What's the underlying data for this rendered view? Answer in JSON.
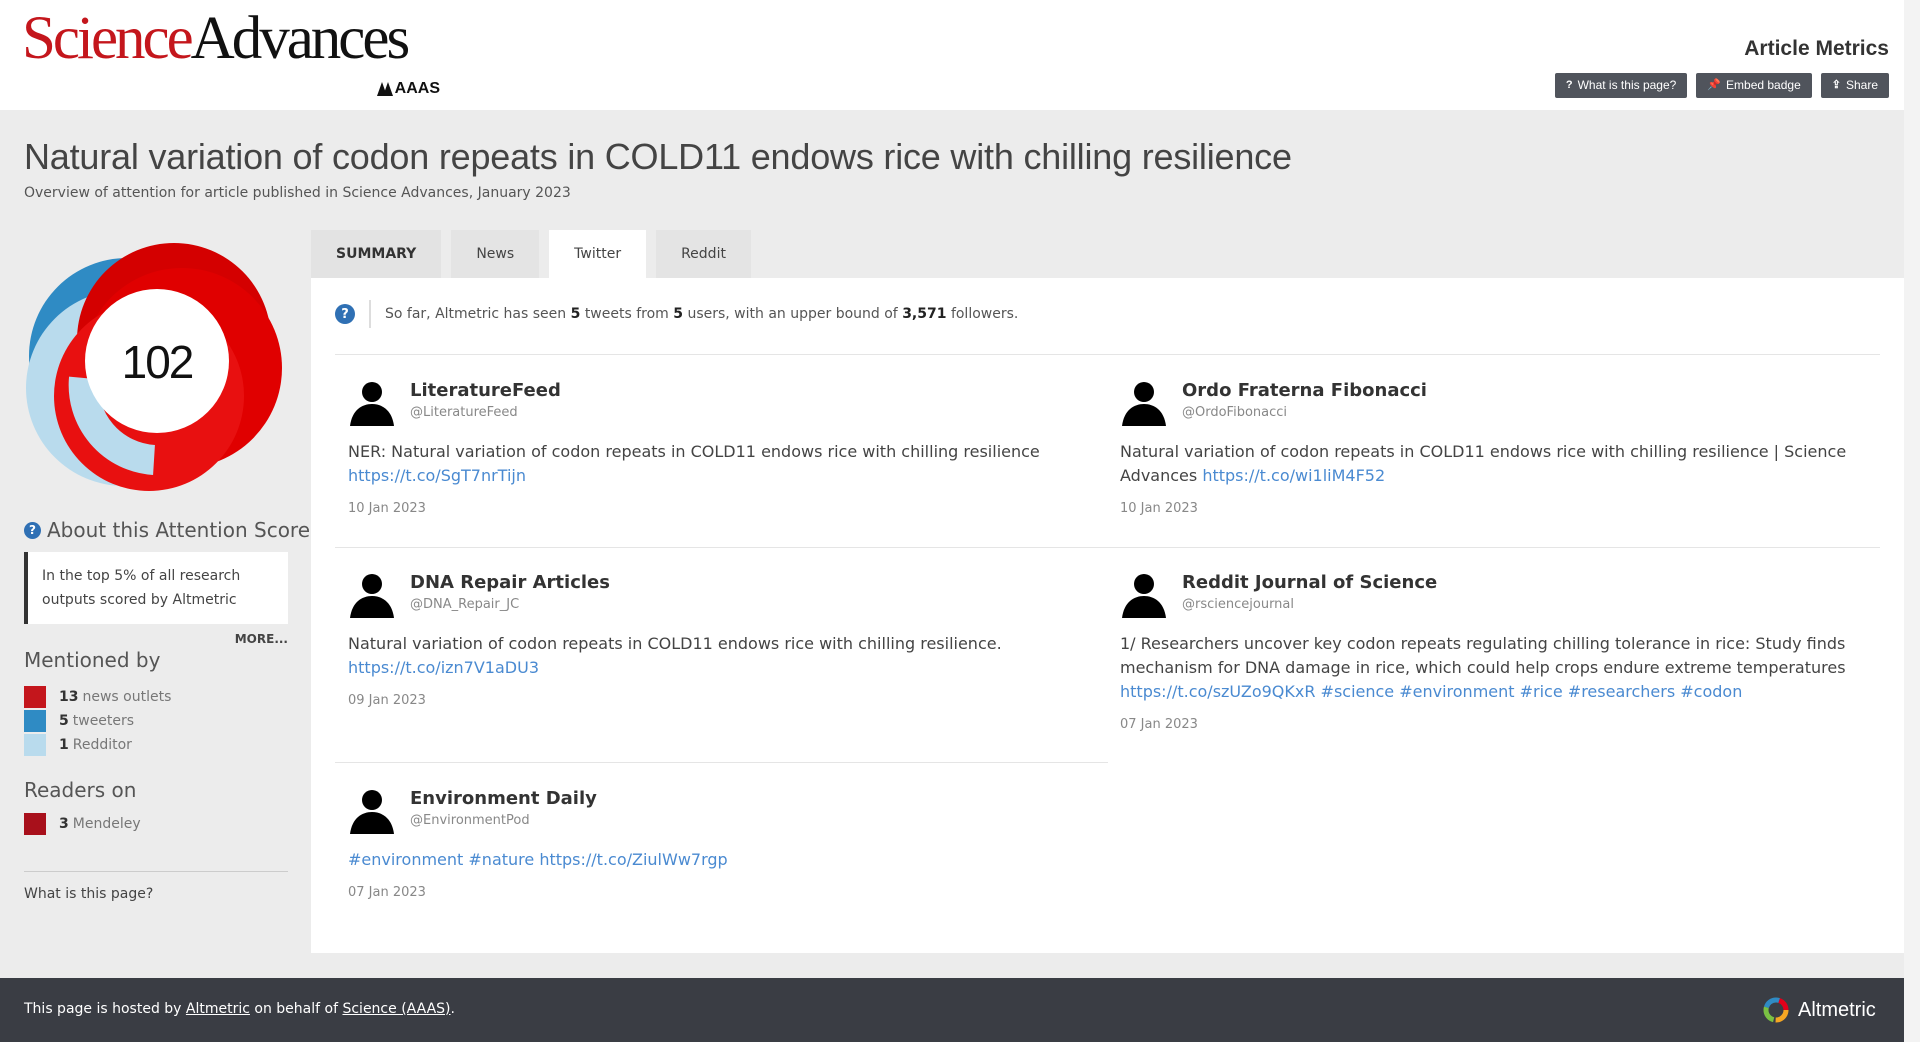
{
  "header": {
    "logo_science": "Science",
    "logo_advances": "Advances",
    "logo_aaas": "AAAS",
    "title": "Article Metrics",
    "buttons": [
      {
        "label": "What is this page?",
        "icon": "question-icon"
      },
      {
        "label": "Embed badge",
        "icon": "pin-icon"
      },
      {
        "label": "Share",
        "icon": "share-icon"
      }
    ]
  },
  "article": {
    "title": "Natural variation of codon repeats in COLD11 endows rice with chilling resilience",
    "subtitle": "Overview of attention for article published in Science Advances, January 2023"
  },
  "sidebar": {
    "score": "102",
    "about_title": "About this Attention Score",
    "top_text": "In the top 5% of all research outputs scored by Altmetric",
    "more": "MORE...",
    "mentioned_title": "Mentioned by",
    "mentions": [
      {
        "count": "13",
        "label": "news outlets",
        "color": "#c4161c"
      },
      {
        "count": "5",
        "label": "tweeters",
        "color": "#2f8bc4"
      },
      {
        "count": "1",
        "label": "Redditor",
        "color": "#b9dbed"
      }
    ],
    "readers_title": "Readers on",
    "readers": [
      {
        "count": "3",
        "label": "Mendeley",
        "color": "#a8101b"
      }
    ],
    "what_link": "What is this page?"
  },
  "colors": {
    "news": "#e00000",
    "twitter": "#2f8bc4",
    "reddit": "#b9dbed",
    "link": "#4a8ad1",
    "footer_bg": "#3a3d44"
  },
  "tabs": [
    {
      "label": "SUMMARY"
    },
    {
      "label": "News"
    },
    {
      "label": "Twitter"
    },
    {
      "label": "Reddit"
    }
  ],
  "summary": {
    "prefix": "So far, Altmetric has seen",
    "tweets": "5",
    "mid1": "tweets from",
    "users": "5",
    "mid2": "users, with an upper bound of",
    "followers": "3,571",
    "suffix": "followers."
  },
  "tweets": [
    {
      "name": "LiteratureFeed",
      "handle": "@LiteratureFeed",
      "text": "NER: Natural variation of codon repeats in COLD11 endows rice with chilling resilience",
      "link": "https://t.co/SgT7nrTijn",
      "date": "10 Jan 2023"
    },
    {
      "name": "Ordo Fraterna Fibonacci",
      "handle": "@OrdoFibonacci",
      "text": "Natural variation of codon repeats in COLD11 endows rice with chilling resilience | Science Advances",
      "link": "https://t.co/wi1liM4F52",
      "date": "10 Jan 2023"
    },
    {
      "name": "DNA Repair Articles",
      "handle": "@DNA_Repair_JC",
      "text": "Natural variation of codon repeats in COLD11 endows rice with chilling resilience.",
      "link": "https://t.co/izn7V1aDU3",
      "date": "09 Jan 2023"
    },
    {
      "name": "Reddit Journal of Science",
      "handle": "@rsciencejournal",
      "text": "1/ Researchers uncover key codon repeats regulating chilling tolerance in rice: Study finds mechanism for DNA damage in rice, which could help crops endure extreme temperatures",
      "link": "https://t.co/szUZo9QKxR #science #environment #rice #researchers #codon",
      "date": "07 Jan 2023"
    },
    {
      "name": "Environment Daily",
      "handle": "@EnvironmentPod",
      "text": "",
      "link": "#environment #nature https://t.co/ZiulWw7rgp",
      "date": "07 Jan 2023"
    }
  ],
  "footer": {
    "prefix": "This page is hosted by",
    "altmetric_link": "Altmetric",
    "mid": "on behalf of",
    "science_link": "Science (AAAS)",
    "suffix": ".",
    "brand": "Altmetric"
  }
}
